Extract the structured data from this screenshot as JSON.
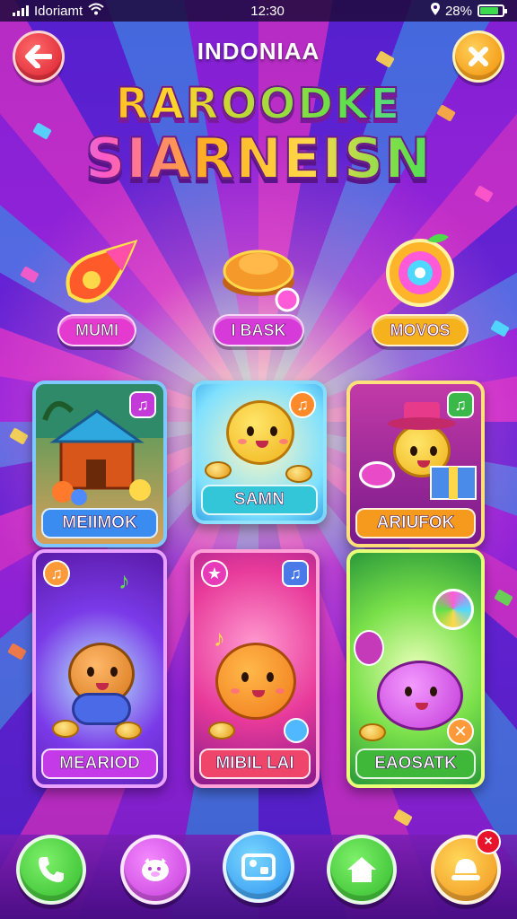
{
  "status_bar": {
    "carrier": "Idoriamt",
    "time": "12:30",
    "battery": "28%",
    "battery_level": 0.85
  },
  "header": {
    "region": "INDONIAA",
    "title_line1": "RAROODKE",
    "title_line2": "SIARNEISN"
  },
  "modes": [
    {
      "label": "MUMI",
      "color": "#e43ad0"
    },
    {
      "label": "I BASK",
      "color": "#d63ad8"
    },
    {
      "label": "MOVOS",
      "color": "#f5b21c"
    }
  ],
  "cards": [
    {
      "label": "MEIIMOK",
      "frame": "#3fa8ff",
      "label_color": "#3a8cf0",
      "icon": "music-tag-icon"
    },
    {
      "label": "SAMN",
      "frame": "#7ee0ff",
      "label_color": "#33c6d8",
      "icon": "music-tag-icon"
    },
    {
      "label": "ARIUFOK",
      "frame": "#ffd24a",
      "label_color": "#f59a1c",
      "icon": "music-tag-icon"
    },
    {
      "label": "MEARIOD",
      "frame": "#c94cff",
      "label_color": "#c53ae8",
      "icon": "music-tag-icon"
    },
    {
      "label": "MIBIL LAI",
      "frame": "#ff6fb0",
      "label_color": "#f0456a",
      "icon": "music-tag-icon"
    },
    {
      "label": "EAOSATK",
      "frame": "#b8f25a",
      "label_color": "#3fb83a",
      "icon": "close-tag-icon"
    }
  ],
  "bottom_nav": [
    {
      "icon": "phone-icon",
      "color": "#35c93a"
    },
    {
      "icon": "pig-icon",
      "color": "#d94ad8"
    },
    {
      "icon": "photos-icon",
      "color": "#2a9ff0"
    },
    {
      "icon": "home-icon",
      "color": "#36c43a"
    },
    {
      "icon": "trophy-icon",
      "color": "#f5a81c"
    }
  ],
  "notification_count": "×"
}
